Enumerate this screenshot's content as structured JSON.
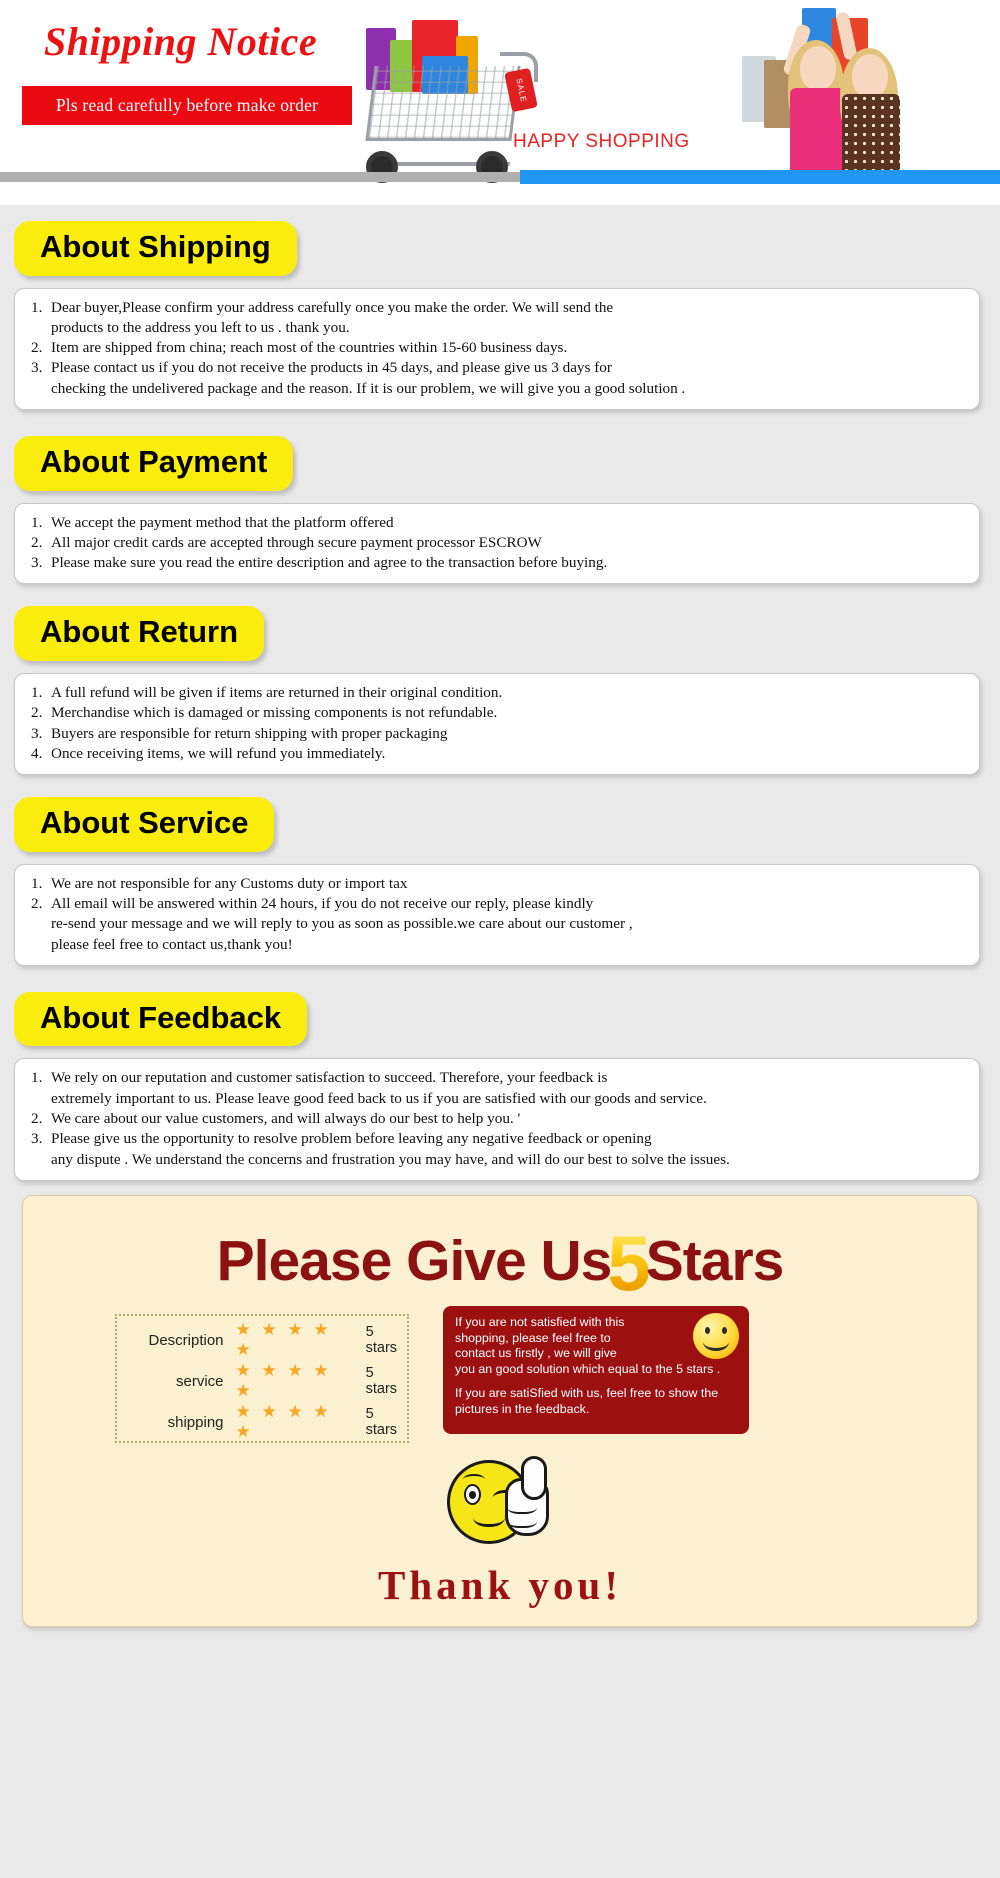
{
  "header": {
    "title": "Shipping Notice",
    "ribbon": "Pls read carefully before make order",
    "happy_shopping": "HAPPY SHOPPING",
    "sale_tag": "SALE",
    "colors": {
      "title_red": "#ee1111",
      "ribbon_red": "#ec0a12",
      "blue_bar": "#2196f3"
    }
  },
  "sections": [
    {
      "badge": "About Shipping",
      "items": [
        {
          "num": "1.",
          "text": "Dear buyer,Please confirm your address carefully once you make the order. We will send the\nproducts to the address you left to us . thank you."
        },
        {
          "num": "2.",
          "text": "Item are shipped from china; reach most of the countries within 15-60 business days."
        },
        {
          "num": "3.",
          "text": "Please contact us if you do not receive the products in 45 days, and please give us 3 days for\nchecking the undelivered package and the reason. If it is our problem, we will give you a good solution ."
        }
      ]
    },
    {
      "badge": "About Payment",
      "items": [
        {
          "num": "1.",
          "text": "We accept the payment method that the platform offered"
        },
        {
          "num": "2.",
          "text": "All major credit cards are accepted through secure payment processor ESCROW"
        },
        {
          "num": "3.",
          "text": "Please make sure you read the entire description and agree to the transaction before buying."
        }
      ]
    },
    {
      "badge": "About Return",
      "items": [
        {
          "num": "1.",
          "text": "A full refund will be given if items are returned in their original condition."
        },
        {
          "num": "2.",
          "text": "Merchandise which is damaged or missing components is not refundable."
        },
        {
          "num": "3.",
          "text": "Buyers are responsible for return shipping with proper packaging"
        },
        {
          "num": "4.",
          "text": "Once receiving items, we will refund you immediately."
        }
      ]
    },
    {
      "badge": "About Service",
      "items": [
        {
          "num": "1.",
          "text": "We are not responsible for any Customs duty or import tax"
        },
        {
          "num": "2.",
          "text": "All email will be answered within 24 hours, if you do not receive our reply, please kindly\nre-send your message and we will reply to you as soon as possible.we care about our customer ,\nplease feel free to contact us,thank you!"
        }
      ]
    },
    {
      "badge": "About Feedback",
      "items": [
        {
          "num": "1.",
          "text": "We rely on our reputation and customer satisfaction to succeed. Therefore, your feedback is\nextremely important to us. Please leave good feed back to us if you are satisfied with our goods and service."
        },
        {
          "num": "2.",
          "text": "We care about our value customers, and will always do our best to help you. '"
        },
        {
          "num": "3.",
          "text": "Please give us the opportunity to resolve problem before leaving any negative feedback or opening\nany dispute . We understand the concerns and frustration you may have, and will do our best to solve the issues."
        }
      ]
    }
  ],
  "stars_banner": {
    "heading_before": "Please Give Us",
    "heading_number": "5",
    "heading_after": "Stars",
    "ratings": [
      {
        "label": "Description",
        "stars": "★ ★ ★ ★ ★",
        "value": "5 stars"
      },
      {
        "label": "service",
        "stars": "★ ★ ★ ★ ★",
        "value": "5 stars"
      },
      {
        "label": "shipping",
        "stars": "★ ★ ★ ★ ★",
        "value": "5 stars"
      }
    ],
    "red_note_1": "If you are not satisfied with this\nshopping, please feel free to\ncontact us firstly , we will give\nyou an good solution which equal to the 5 stars .",
    "red_note_2": "If you are satiSfied with us, feel free to show the\npictures in the feedback.",
    "thank_you": "Thank you!",
    "colors": {
      "banner_bg": "#fbf0cf",
      "heading_red": "#8c1111",
      "gold": "#ffd21f",
      "red_box": "#9c1010",
      "star_orange": "#f5a623"
    }
  }
}
